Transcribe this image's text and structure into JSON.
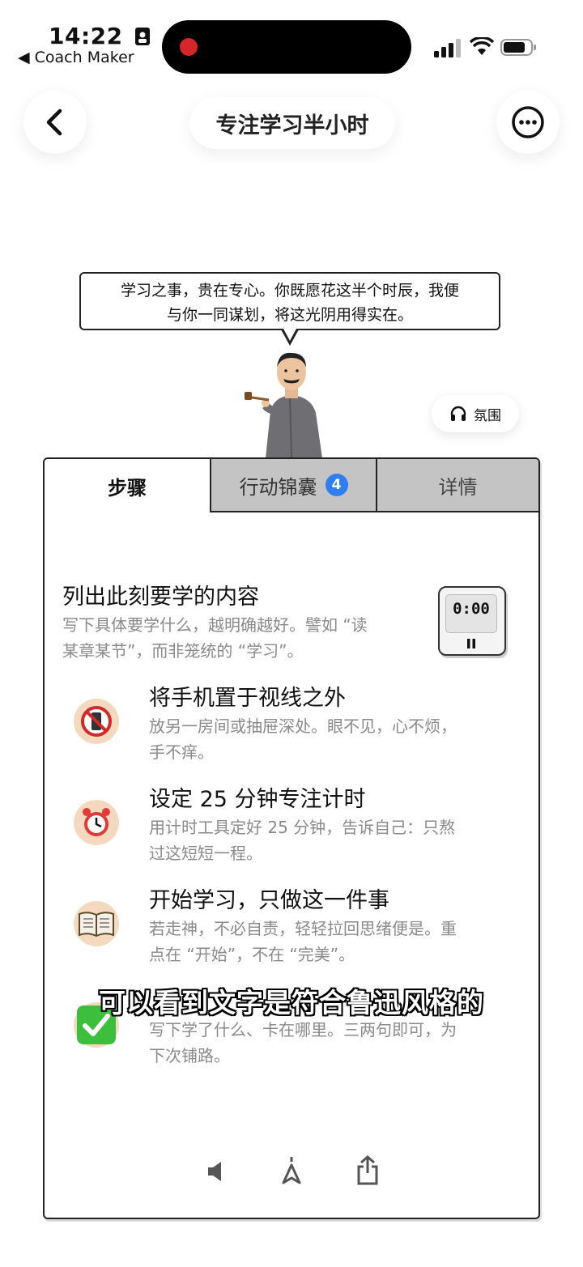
{
  "status_bar": {
    "time": "14:22",
    "back_app": "◀ Coach Maker"
  },
  "header": {
    "title": "专注学习半小时"
  },
  "mentor": {
    "speech_line1": "学习之事，贵在专心。你既愿花这半个时辰，我便",
    "speech_line2": "与你一同谋划，将这光阴用得实在。",
    "ambience_label": "氛围"
  },
  "tabs": [
    {
      "label": "步骤"
    },
    {
      "label": "行动锦囊",
      "badge": "4"
    },
    {
      "label": "详情"
    }
  ],
  "steps": [
    {
      "title": "列出此刻要学的内容",
      "desc1": "写下具体要学什么，越明确越好。譬如 “读",
      "desc2": "某章某节”，而非笼统的 “学习”。"
    },
    {
      "title": "将手机置于视线之外",
      "desc1": "放另一房间或抽屉深处。眼不见，心不烦，",
      "desc2": "手不痒。"
    },
    {
      "title": "设定 25 分钟专注计时",
      "desc1": "用计时工具定好 25 分钟，告诉自己：只熬",
      "desc2": "过这短短一程。"
    },
    {
      "title": "开始学习，只做这一件事",
      "desc1": "若走神，不必自责，轻轻拉回思绪便是。重",
      "desc2": "点在 “开始”，不在 “完美”。"
    },
    {
      "title": "",
      "desc1": "写下学了什么、卡在哪里。三两句即可，为",
      "desc2": "下次铺路。"
    }
  ],
  "timer_widget": {
    "display": "0:00"
  },
  "subtitle_overlay": "可以看到文字是符合鲁迅风格的",
  "icons": [
    "back-icon",
    "more-icon",
    "headphones-icon",
    "no-phone-icon",
    "alarm-clock-icon",
    "open-book-icon",
    "check-icon",
    "speaker-icon",
    "navigation-icon",
    "share-icon",
    "pause-icon"
  ]
}
